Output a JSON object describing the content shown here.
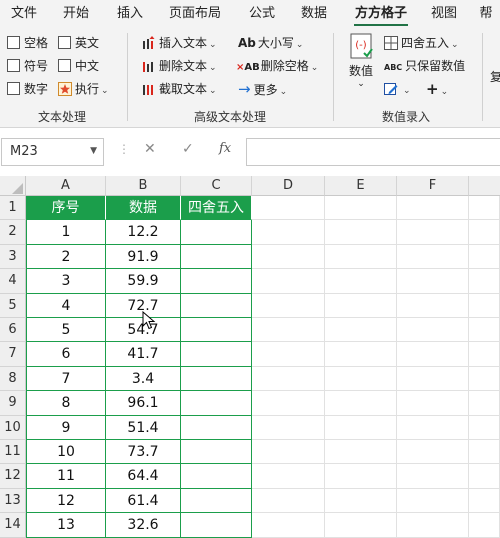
{
  "ribbon_tabs": [
    {
      "label": "文件"
    },
    {
      "label": "开始"
    },
    {
      "label": "插入"
    },
    {
      "label": "页面布局"
    },
    {
      "label": "公式"
    },
    {
      "label": "数据"
    },
    {
      "label": "方方格子",
      "active": true
    },
    {
      "label": "视图"
    },
    {
      "label": "帮"
    }
  ],
  "text_processing": {
    "checkboxes": [
      {
        "label": "空格",
        "checked": false
      },
      {
        "label": "英文",
        "checked": false
      },
      {
        "label": "符号",
        "checked": false
      },
      {
        "label": "中文",
        "checked": false
      },
      {
        "label": "数字",
        "checked": false
      }
    ],
    "execute_label": "执行",
    "group_label": "文本处理"
  },
  "advanced_text": {
    "insert_text": "插入文本",
    "delete_text": "删除文本",
    "cut_text": "截取文本",
    "case_label": "大小写",
    "delete_space": "删除空格",
    "more": "更多",
    "group_label": "高级文本处理"
  },
  "numeric_entry": {
    "numeric_label": "数值",
    "rounding": "四舍五入",
    "keep_values": "只保留数值",
    "group_label": "数值录入"
  },
  "formula_bar": {
    "name_box": "M23",
    "cancel_symbol": "✕",
    "confirm_symbol": "✓",
    "fx_symbol": "fx",
    "formula": ""
  },
  "sheet": {
    "columns": [
      "A",
      "B",
      "C",
      "D",
      "E",
      "F"
    ],
    "headers": [
      "序号",
      "数据",
      "四舍五入"
    ],
    "rows": [
      {
        "row": "1"
      },
      {
        "row": "2",
        "a": "1",
        "b": "12.2"
      },
      {
        "row": "3",
        "a": "2",
        "b": "91.9"
      },
      {
        "row": "4",
        "a": "3",
        "b": "59.9"
      },
      {
        "row": "5",
        "a": "4",
        "b": "72.7"
      },
      {
        "row": "6",
        "a": "5",
        "b": "54.7"
      },
      {
        "row": "7",
        "a": "6",
        "b": "41.7"
      },
      {
        "row": "8",
        "a": "7",
        "b": "3.4"
      },
      {
        "row": "9",
        "a": "8",
        "b": "96.1"
      },
      {
        "row": "10",
        "a": "9",
        "b": "51.4"
      },
      {
        "row": "11",
        "a": "10",
        "b": "73.7"
      },
      {
        "row": "12",
        "a": "11",
        "b": "64.4"
      },
      {
        "row": "13",
        "a": "12",
        "b": "61.4"
      },
      {
        "row": "14",
        "a": "13",
        "b": "32.6"
      }
    ]
  },
  "colors": {
    "header_green": "#1b9e4b",
    "active_tab_underline": "#217346"
  }
}
